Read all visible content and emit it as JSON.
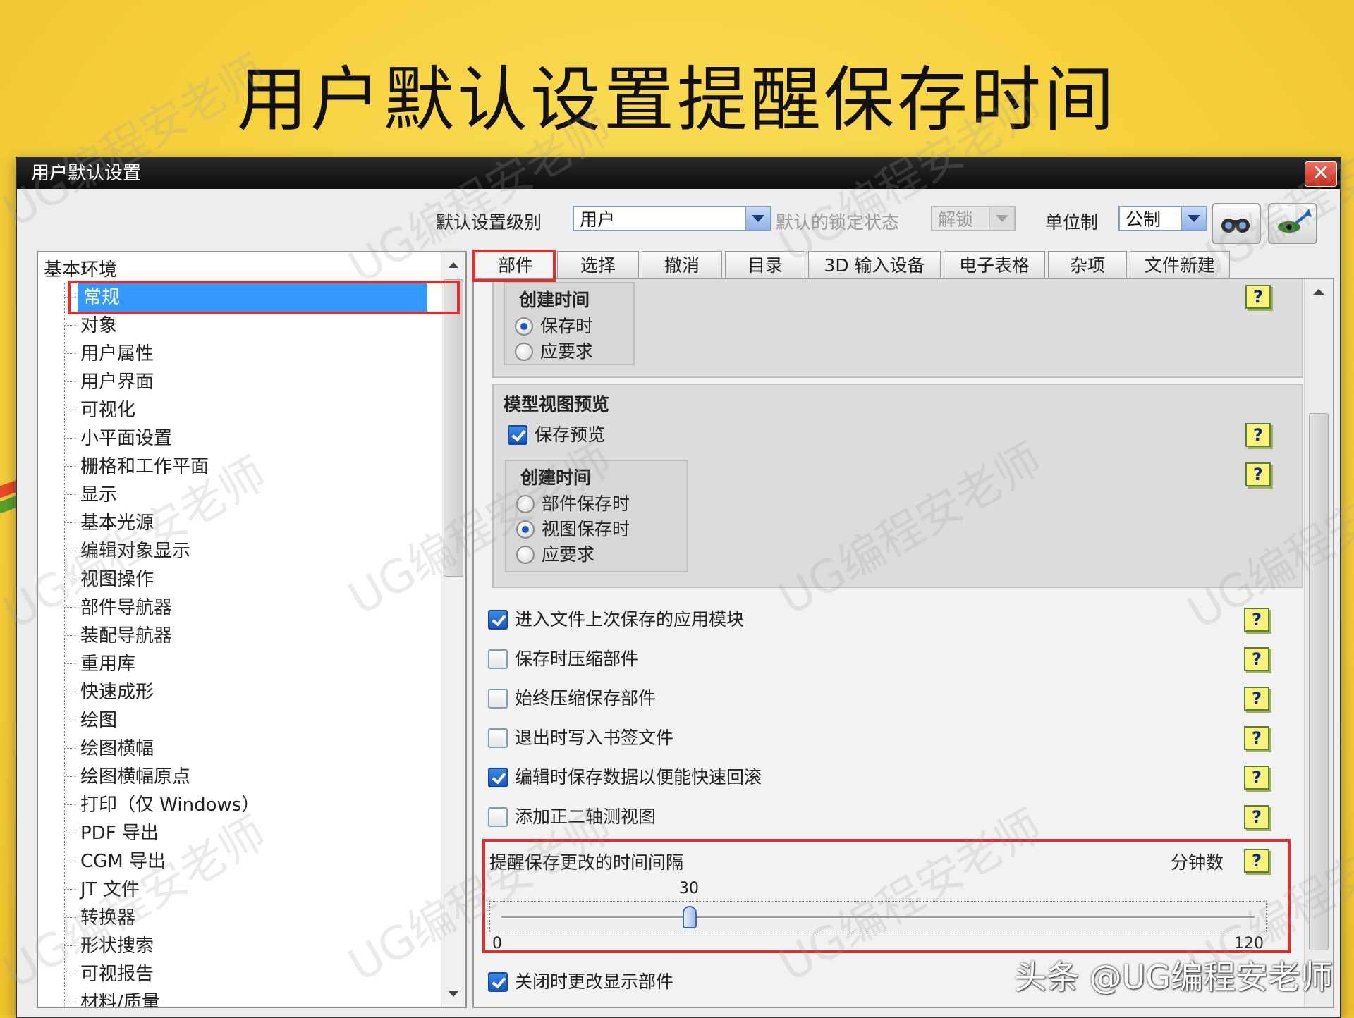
{
  "slide": {
    "title": "用户默认设置提醒保存时间",
    "watermark": "UG编程安老师",
    "brand": "头条 @UG编程安老师"
  },
  "window": {
    "title": "用户默认设置",
    "close_glyph": "✕"
  },
  "toolbar": {
    "level_label": "默认设置级别",
    "level_value": "用户",
    "lock_label": "默认的锁定状态",
    "lock_value": "解锁",
    "unit_label": "单位制",
    "unit_value": "公制",
    "btn1_icon": "binoculars-icon",
    "btn2_icon": "eye-arrow-icon"
  },
  "tree": {
    "root": "基本环境",
    "items": [
      "常规",
      "对象",
      "用户属性",
      "用户界面",
      "可视化",
      "小平面设置",
      "栅格和工作平面",
      "显示",
      "基本光源",
      "编辑对象显示",
      "视图操作",
      "部件导航器",
      "装配导航器",
      "重用库",
      "快速成形",
      "绘图",
      "绘图横幅",
      "绘图横幅原点",
      "打印（仅 Windows）",
      "PDF 导出",
      "CGM 导出",
      "JT 文件",
      "转换器",
      "形状搜索",
      "可视报告",
      "材料/质量"
    ],
    "selected_index": 0
  },
  "tabs": [
    "部件",
    "选择",
    "撤消",
    "目录",
    "3D 输入设备",
    "电子表格",
    "杂项",
    "文件新建"
  ],
  "active_tab": 0,
  "panel": {
    "group1": {
      "title": "创建时间",
      "options": [
        "保存时",
        "应要求"
      ],
      "selected": 0
    },
    "preview_group": {
      "title": "模型视图预览",
      "save_preview_label": "保存预览",
      "save_preview_checked": true,
      "sub_title": "创建时间",
      "options": [
        "部件保存时",
        "视图保存时",
        "应要求"
      ],
      "selected": 1
    },
    "checks": [
      {
        "label": "进入文件上次保存的应用模块",
        "checked": true
      },
      {
        "label": "保存时压缩部件",
        "checked": false
      },
      {
        "label": "始终压缩保存部件",
        "checked": false
      },
      {
        "label": "退出时写入书签文件",
        "checked": false
      },
      {
        "label": "编辑时保存数据以便能快速回滚",
        "checked": true
      },
      {
        "label": "添加正二轴测视图",
        "checked": false
      }
    ],
    "slider": {
      "label": "提醒保存更改的时间间隔",
      "unit": "分钟数",
      "value": 30,
      "value_text": "30",
      "min": 0,
      "max": 120,
      "min_text": "0",
      "max_text": "120"
    },
    "close_check": {
      "label": "关闭时更改显示部件",
      "checked": true
    },
    "help_glyph": "?"
  },
  "colors": {
    "highlight": "#e02d2d",
    "selection": "#3399ff",
    "background": "#f6d23f"
  }
}
